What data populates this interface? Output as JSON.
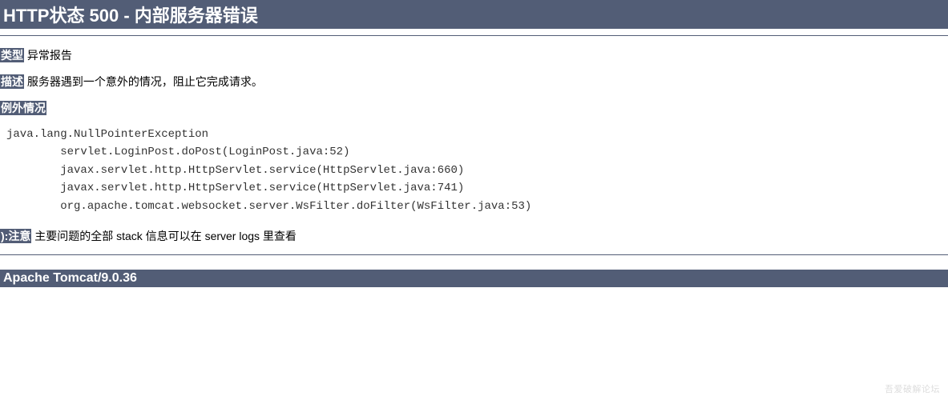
{
  "title": "HTTP状态 500 - 内部服务器错误",
  "type": {
    "label": "类型",
    "value": "异常报告"
  },
  "description": {
    "label": "描述",
    "value": "服务器遇到一个意外的情况，阻止它完成请求。"
  },
  "exception": {
    "label": "例外情况",
    "stack": "java.lang.NullPointerException\n\tservlet.LoginPost.doPost(LoginPost.java:52)\n\tjavax.servlet.http.HttpServlet.service(HttpServlet.java:660)\n\tjavax.servlet.http.HttpServlet.service(HttpServlet.java:741)\n\torg.apache.tomcat.websocket.server.WsFilter.doFilter(WsFilter.java:53)"
  },
  "note": {
    "label": "):注意",
    "value": "主要问题的全部 stack 信息可以在 server logs 里查看"
  },
  "footer": "Apache Tomcat/9.0.36",
  "watermark": "吾爱破解论坛"
}
